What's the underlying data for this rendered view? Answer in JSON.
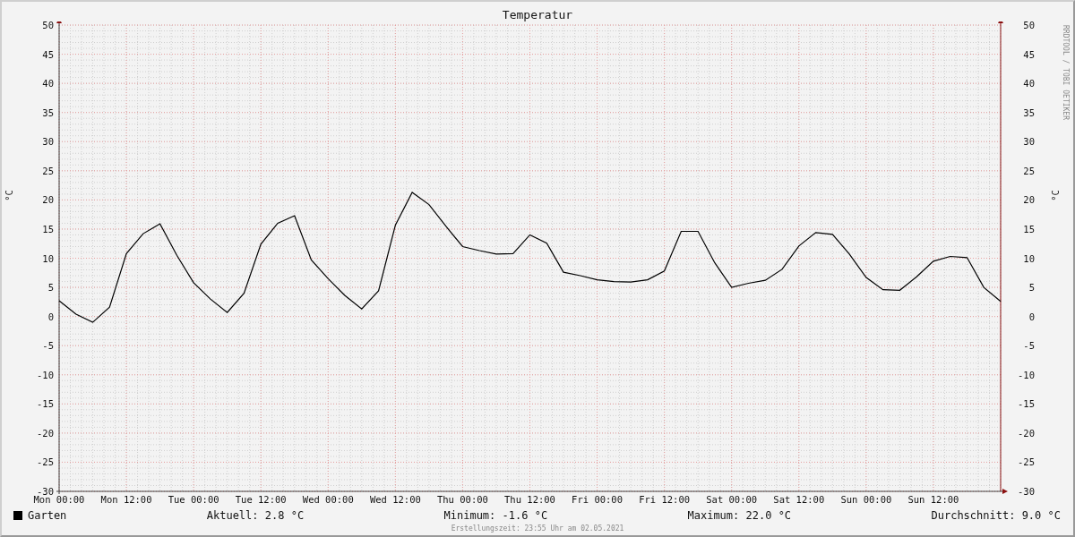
{
  "graph": {
    "title": "Temperatur",
    "watermark": "RRDTOOL / TOBI OETIKER",
    "unit_left": "°C",
    "unit_right": "°C",
    "right_axis_labels": [
      "50",
      "45",
      "40",
      "35",
      "30",
      "25",
      "20",
      "15",
      "10",
      "5",
      "0",
      "-5",
      "-10",
      "-15",
      "-20",
      "-25",
      "-30"
    ],
    "chart_data": {
      "type": "line",
      "grid": true,
      "ylim": [
        -30,
        50
      ],
      "yticks": [
        -30,
        -25,
        -20,
        -15,
        -10,
        -5,
        0,
        5,
        10,
        15,
        20,
        25,
        30,
        35,
        40,
        45,
        50
      ],
      "categories": [
        "Mon 00:00",
        null,
        null,
        null,
        "Mon 12:00",
        null,
        null,
        null,
        "Tue 00:00",
        null,
        null,
        null,
        "Tue 12:00",
        null,
        null,
        null,
        "Wed 00:00",
        null,
        null,
        null,
        "Wed 12:00",
        null,
        null,
        null,
        "Thu 00:00",
        null,
        null,
        null,
        "Thu 12:00",
        null,
        null,
        null,
        "Fri 00:00",
        null,
        null,
        null,
        "Fri 12:00",
        null,
        null,
        null,
        "Sat 00:00",
        null,
        null,
        null,
        "Sat 12:00",
        null,
        null,
        null,
        "Sun 00:00",
        null,
        null,
        null,
        "Sun 12:00",
        null,
        null,
        null,
        null
      ],
      "series": [
        {
          "name": "Garten",
          "color": "#000000",
          "values": [
            2.7,
            0.4,
            -1.0,
            1.6,
            10.8,
            14.2,
            15.9,
            10.5,
            5.8,
            3.0,
            0.7,
            4.0,
            12.4,
            16.0,
            17.3,
            9.7,
            6.5,
            3.6,
            1.3,
            4.4,
            15.7,
            21.3,
            19.2,
            15.5,
            12.0,
            11.3,
            10.7,
            10.8,
            14.0,
            12.6,
            7.6,
            7.0,
            6.3,
            6.0,
            5.9,
            6.3,
            7.8,
            14.6,
            14.6,
            9.2,
            5.0,
            5.7,
            6.2,
            8.1,
            12.1,
            14.4,
            14.1,
            10.7,
            6.7,
            4.6,
            4.5,
            6.8,
            9.5,
            10.3,
            10.1,
            5.0,
            2.6
          ]
        }
      ]
    }
  },
  "legend": {
    "stats": [
      "Aktuell: 2.8 °C",
      "Minimum: -1.6 °C",
      "Maximum: 22.0 °C",
      "Durchschnitt: 9.0 °C"
    ]
  },
  "footer": "Erstellungszeit: 23:55 Uhr am 02.05.2021"
}
